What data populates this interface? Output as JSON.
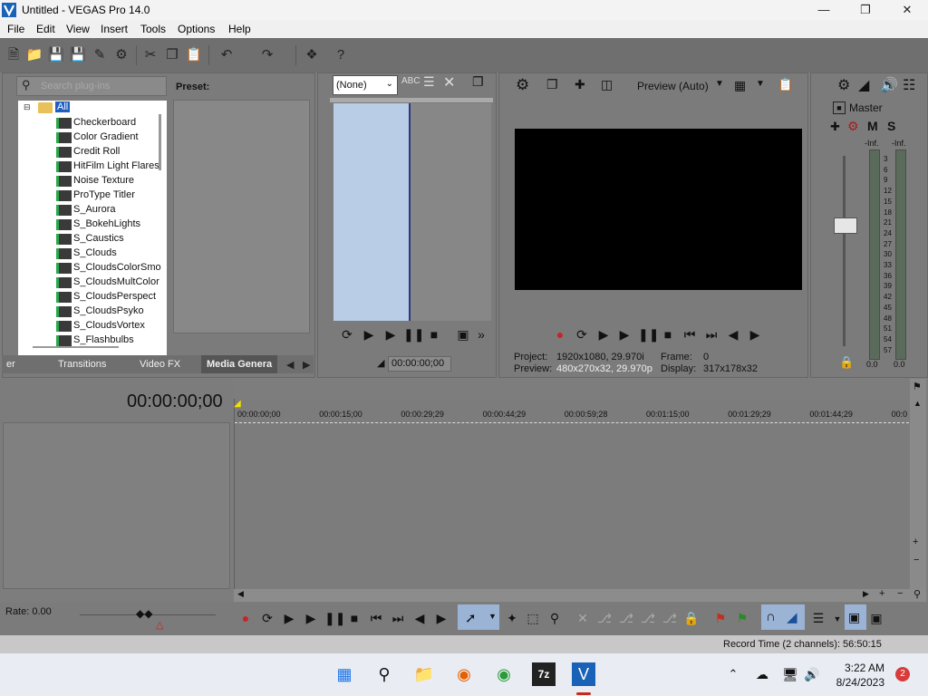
{
  "window": {
    "title": "Untitled - VEGAS Pro 14.0"
  },
  "menu": [
    "File",
    "Edit",
    "View",
    "Insert",
    "Tools",
    "Options",
    "Help"
  ],
  "plugins": {
    "search_placeholder": "Search plug-ins",
    "preset_label": "Preset:",
    "root": "All",
    "items": [
      "Checkerboard",
      "Color Gradient",
      "Credit Roll",
      "HitFilm Light Flares",
      "Noise Texture",
      "ProType Titler",
      "S_Aurora",
      "S_BokehLights",
      "S_Caustics",
      "S_Clouds",
      "S_CloudsColorSmo",
      "S_CloudsMultColor",
      "S_CloudsPerspect",
      "S_CloudsPsyko",
      "S_CloudsVortex",
      "S_Flashbulbs"
    ],
    "tabs": [
      "er",
      "Transitions",
      "Video FX",
      "Media Genera"
    ]
  },
  "trimmer": {
    "selector": "(None)",
    "timecode": "00:00:00;00"
  },
  "preview": {
    "mode": "Preview (Auto)",
    "project_label": "Project:",
    "project_value": "1920x1080, 29.970i",
    "preview_label": "Preview:",
    "preview_value": "480x270x32, 29.970p",
    "frame_label": "Frame:",
    "frame_value": "0",
    "display_label": "Display:",
    "display_value": "317x178x32"
  },
  "master": {
    "label": "Master",
    "m": "M",
    "s": "S",
    "inf_left": "-Inf.",
    "inf_right": "-Inf.",
    "bottom_left": "0.0",
    "bottom_right": "0.0",
    "scale": [
      "3",
      "6",
      "9",
      "12",
      "15",
      "18",
      "21",
      "24",
      "27",
      "30",
      "33",
      "36",
      "39",
      "42",
      "45",
      "48",
      "51",
      "54",
      "57"
    ]
  },
  "timeline": {
    "time_display": "00:00:00;00",
    "ticks": [
      "00:00:00;00",
      "00:00:15;00",
      "00:00:29;29",
      "00:00:44;29",
      "00:00:59;28",
      "00:01:15;00",
      "00:01:29;29",
      "00:01:44;29",
      "00:0"
    ],
    "rate": "Rate: 0.00"
  },
  "status": {
    "record_time": "Record Time (2 channels): 56:50:15"
  },
  "taskbar": {
    "time": "3:22 AM",
    "date": "8/24/2023",
    "notifications": "2"
  },
  "colors": {
    "trim_media": "#b9cde6",
    "accent": "#2f6fd6",
    "record": "#cc2222"
  }
}
